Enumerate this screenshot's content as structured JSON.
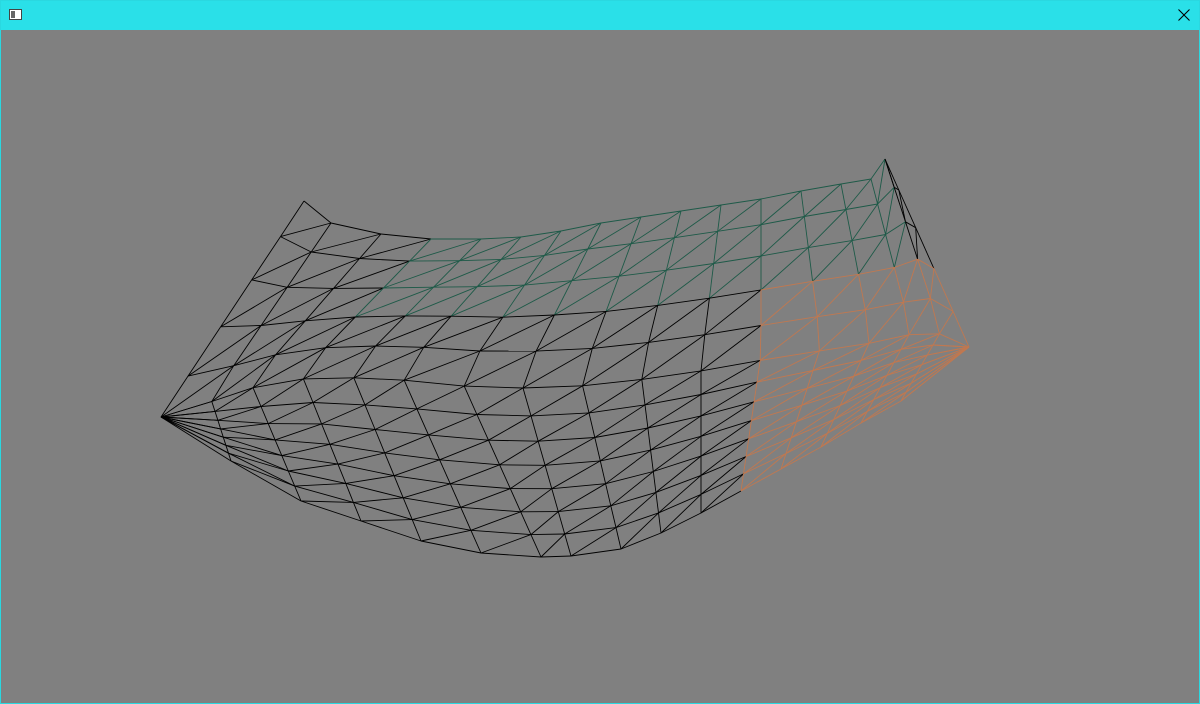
{
  "window": {
    "title": "",
    "titlebar_color": "#2ae0e8",
    "icons": [
      "app-icon",
      "close-icon"
    ]
  },
  "viewport": {
    "background_color": "#808080",
    "content": "3d-wireframe-triangle-mesh",
    "colors": {
      "default_edge": "#000000",
      "back_wall_tint": "#1e5a48",
      "front_edge_tint": "#c07850"
    }
  }
}
